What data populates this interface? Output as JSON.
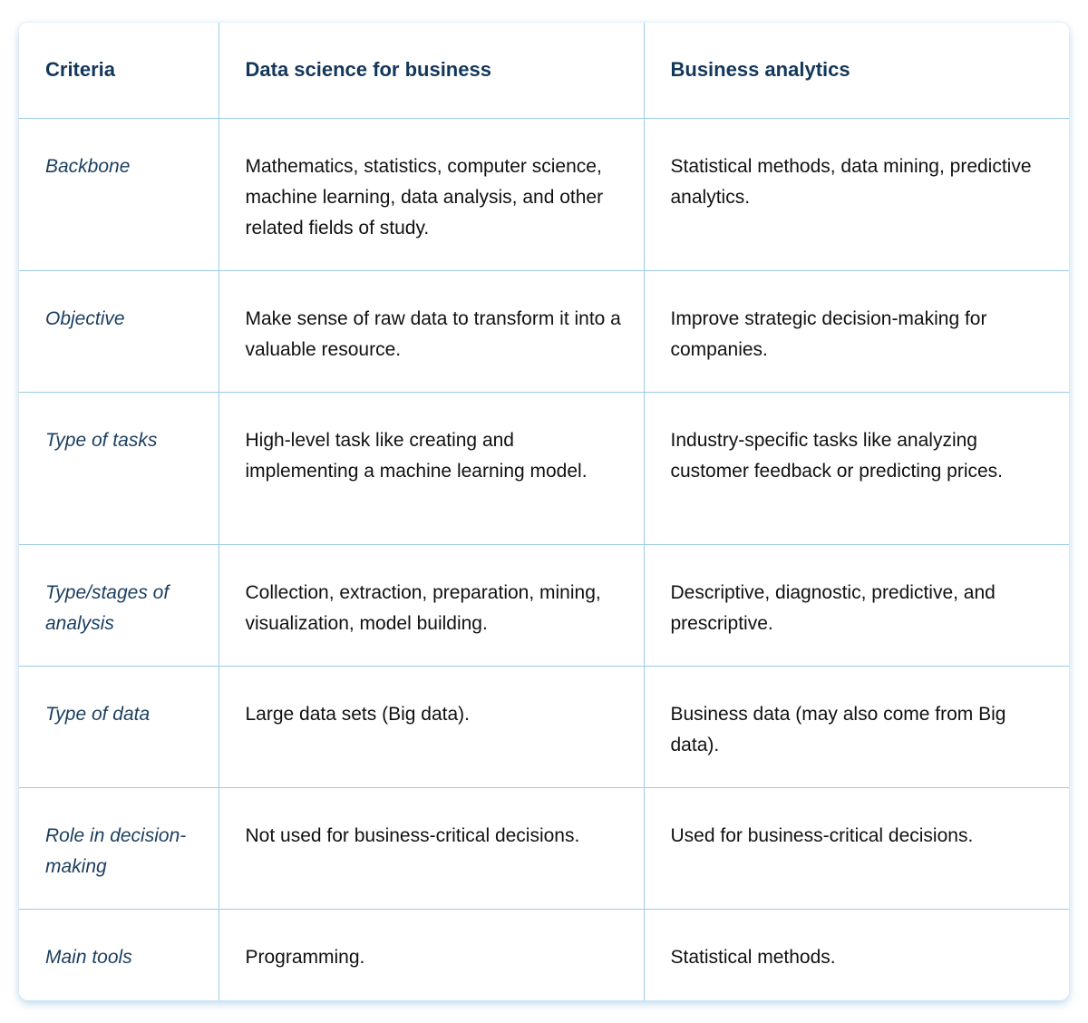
{
  "table": {
    "headers": [
      "Criteria",
      "Data science for business",
      "Business analytics"
    ],
    "rows": [
      {
        "criteria": "Backbone",
        "data_science": "Mathematics, statistics, computer science, machine learning, data analysis, and other related fields of study.",
        "business_analytics": "Statistical methods, data mining, predictive analytics."
      },
      {
        "criteria": "Objective",
        "data_science": "Make sense of raw data to transform it into a valuable resource.",
        "business_analytics": "Improve strategic decision-making for companies."
      },
      {
        "criteria": "Type of tasks",
        "data_science": "High-level task like creating and implementing a machine learning model.",
        "business_analytics": "Industry-specific tasks like analyzing customer feedback or predicting prices."
      },
      {
        "criteria": "Type/stages of analysis",
        "data_science": "Collection, extraction, preparation, mining, visualization, model building.",
        "business_analytics": "Descriptive, diagnostic, predictive, and prescriptive."
      },
      {
        "criteria": "Type of data",
        "data_science": "Large data sets (Big data).",
        "business_analytics": "Business data (may also come from Big data)."
      },
      {
        "criteria": "Role in decision-making",
        "data_science": "Not used for business-critical decisions.",
        "business_analytics": "Used for business-critical decisions."
      },
      {
        "criteria": "Main tools",
        "data_science": "Programming.",
        "business_analytics": "Statistical methods."
      }
    ]
  },
  "colors": {
    "header_text": "#13375a",
    "criteria_text": "#1c3f60",
    "body_text": "#111111",
    "grid_line": "#9ccbe6"
  }
}
